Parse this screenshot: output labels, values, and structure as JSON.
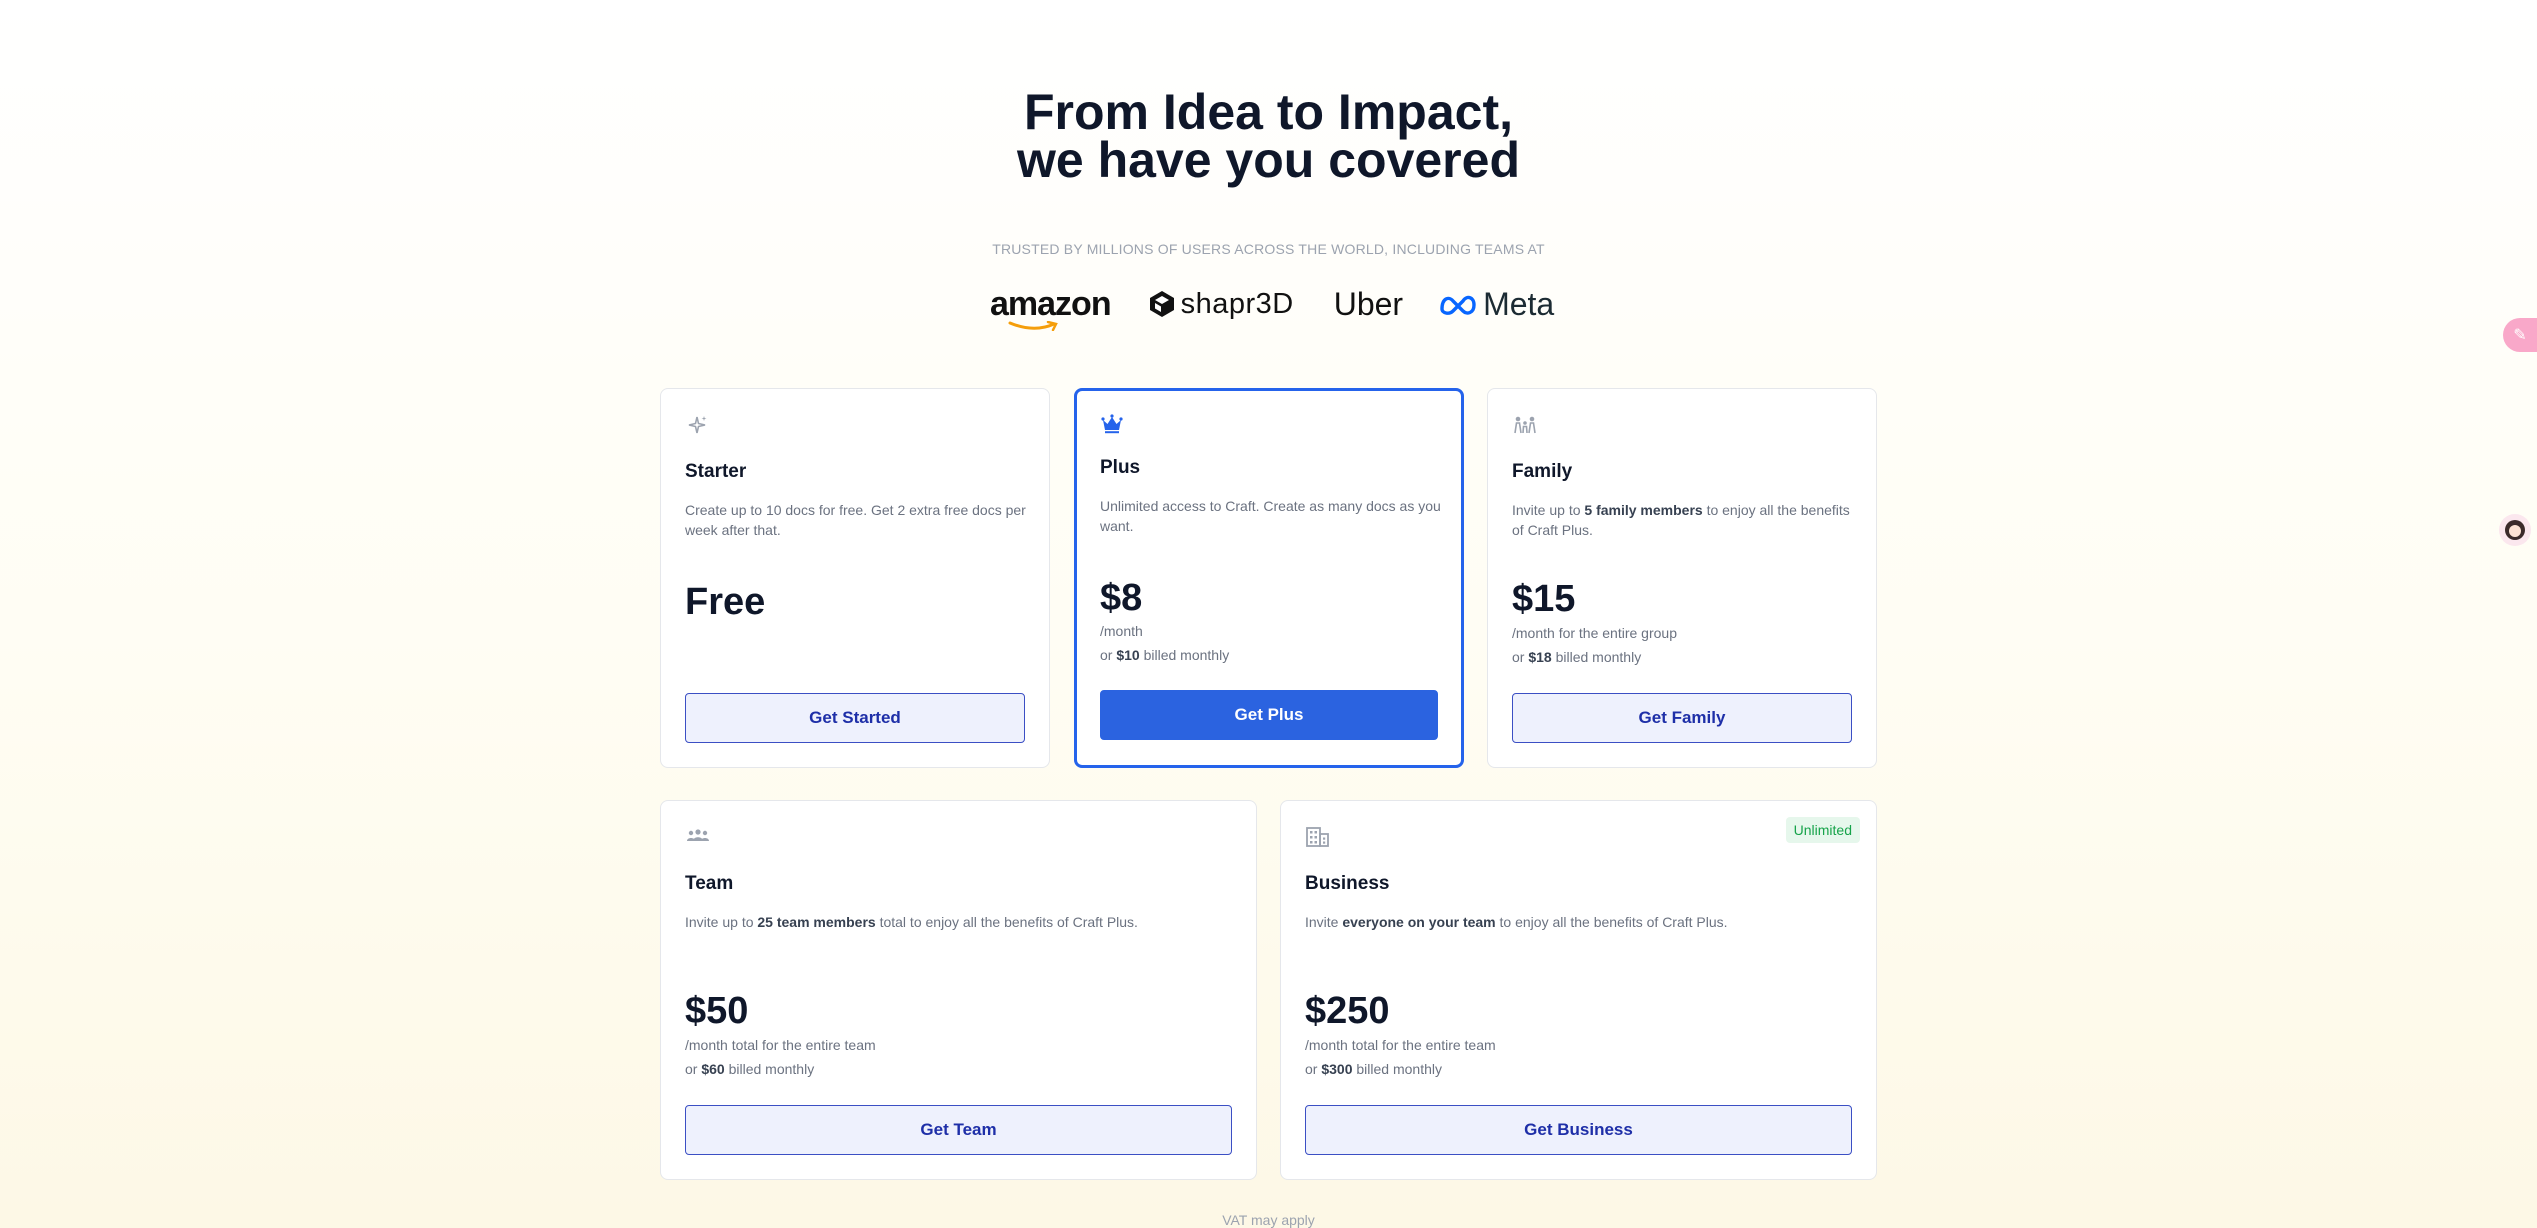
{
  "hero": {
    "title_line1": "From Idea to Impact,",
    "title_line2": "we have you covered"
  },
  "trusted": {
    "text": "TRUSTED BY MILLIONS OF USERS ACROSS THE WORLD, INCLUDING TEAMS AT",
    "logos": [
      "amazon",
      "shapr3D",
      "Uber",
      "Meta"
    ]
  },
  "plans": {
    "starter": {
      "name": "Starter",
      "desc": "Create up to 10 docs for free. Get 2 extra free docs per week after that.",
      "price": "Free",
      "button": "Get Started",
      "icon": "sparkle-icon"
    },
    "plus": {
      "name": "Plus",
      "desc": "Unlimited access to Craft. Create as many docs as you want.",
      "price": "$8",
      "period": "/month",
      "billed_prefix": "or ",
      "billed_amount": "$10",
      "billed_suffix": " billed monthly",
      "button": "Get Plus",
      "icon": "crown-icon"
    },
    "family": {
      "name": "Family",
      "desc_prefix": "Invite up to ",
      "desc_bold": "5 family members",
      "desc_suffix": " to enjoy all the benefits of Craft Plus.",
      "price": "$15",
      "period": "/month for the entire group",
      "billed_prefix": "or ",
      "billed_amount": "$18",
      "billed_suffix": " billed monthly",
      "button": "Get Family",
      "icon": "family-icon"
    },
    "team": {
      "name": "Team",
      "desc_prefix": "Invite up to ",
      "desc_bold": "25 team members",
      "desc_suffix": " total to enjoy all the benefits of Craft Plus.",
      "price": "$50",
      "period": "/month total for the entire team",
      "billed_prefix": "or ",
      "billed_amount": "$60",
      "billed_suffix": " billed monthly",
      "button": "Get Team",
      "icon": "team-icon"
    },
    "business": {
      "name": "Business",
      "badge": "Unlimited",
      "desc_prefix": "Invite ",
      "desc_bold": "everyone on your team",
      "desc_suffix": " to enjoy all the benefits of Craft Plus.",
      "price": "$250",
      "period": "/month total for the entire team",
      "billed_prefix": "or ",
      "billed_amount": "$300",
      "billed_suffix": " billed monthly",
      "button": "Get Business",
      "icon": "building-icon"
    }
  },
  "footer": {
    "vat": "VAT may apply"
  },
  "colors": {
    "accent": "#2563eb",
    "badge": "#16a34a"
  }
}
